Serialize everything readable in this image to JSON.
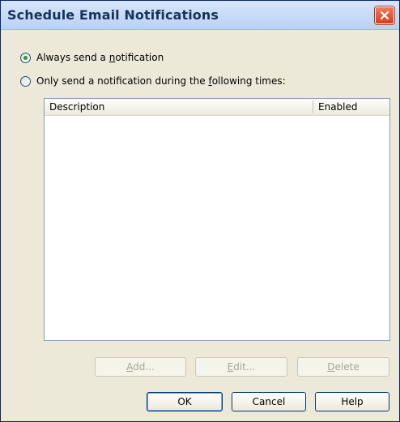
{
  "window": {
    "title": "Schedule Email Notifications"
  },
  "options": {
    "always": {
      "prefix": "Always send a ",
      "accel": "n",
      "suffix": "otification",
      "checked": true
    },
    "scheduled": {
      "prefix": "Only send a notification during the ",
      "accel": "f",
      "suffix": "ollowing times:",
      "checked": false
    }
  },
  "list": {
    "columns": {
      "description": "Description",
      "enabled": "Enabled"
    },
    "rows": []
  },
  "list_buttons": {
    "add": {
      "accel": "A",
      "rest": "dd..."
    },
    "edit": {
      "accel": "E",
      "rest": "dit..."
    },
    "delete": {
      "accel": "D",
      "rest": "elete"
    }
  },
  "dialog_buttons": {
    "ok": "OK",
    "cancel": "Cancel",
    "help": "Help"
  },
  "icons": {
    "close": "close-icon"
  },
  "colors": {
    "title_bar": "#c6dbf7",
    "close_button": "#e0502f",
    "radio_selected": "#21a121",
    "dialog_face": "#ece9d8"
  }
}
